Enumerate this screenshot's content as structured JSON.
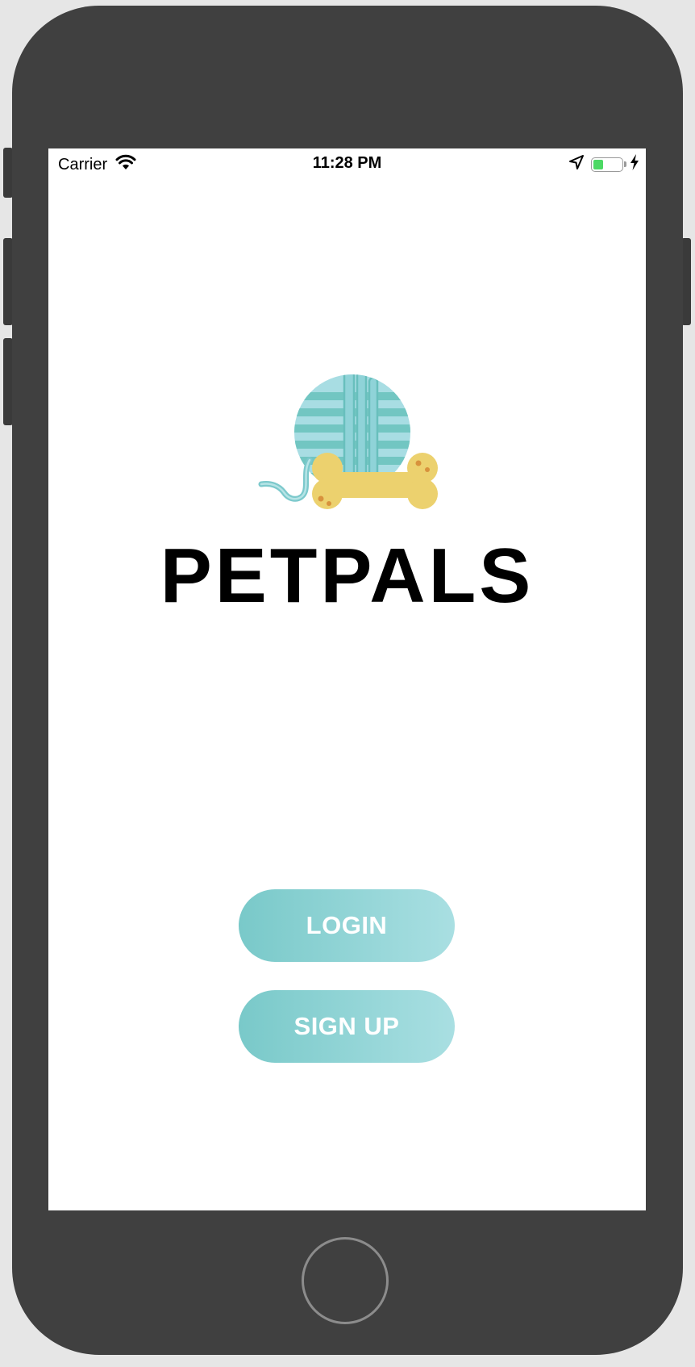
{
  "status_bar": {
    "carrier": "Carrier",
    "time": "11:28 PM",
    "battery_level": 0.35,
    "battery_color": "#4cd964"
  },
  "brand": {
    "title": "PETPALS",
    "logo_icon": "yarn-ball-bone-logo"
  },
  "actions": {
    "login_label": "LOGIN",
    "signup_label": "SIGN UP"
  },
  "colors": {
    "button_gradient_start": "#79c9c9",
    "button_gradient_end": "#a9dfe2",
    "device_frame": "#404040",
    "bone": "#ecd16e",
    "yarn": "#a8dde3"
  }
}
